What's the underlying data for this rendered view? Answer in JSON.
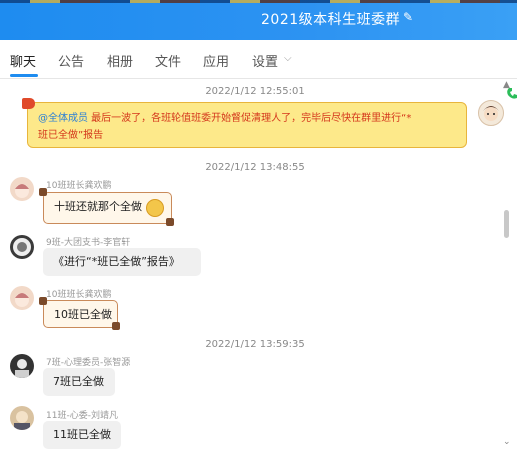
{
  "header": {
    "title": "2021级本科生班委群"
  },
  "tabs": [
    {
      "label": "聊天"
    },
    {
      "label": "公告"
    },
    {
      "label": "相册"
    },
    {
      "label": "文件"
    },
    {
      "label": "应用"
    },
    {
      "label": "设置"
    }
  ],
  "messages": {
    "t1": "2022/1/12 12:55:01",
    "announce": {
      "at": "@全体成员",
      "line1": " 最后一波了，各班轮值班委开始督促清理人了，完毕后尽快在群里进行“*",
      "line2": "班已全做”报告"
    },
    "t2": "2022/1/12 13:48:55",
    "m1": {
      "sender": "10班班长龚欢鹏",
      "text": "十班还就那个全做"
    },
    "m2": {
      "sender": "9班-大团支书-李官轩",
      "text": "《进行“*班已全做”报告》"
    },
    "m3": {
      "sender": "10班班长龚欢鹏",
      "text": "10班已全做"
    },
    "t3": "2022/1/12 13:59:35",
    "m4": {
      "sender": "7班-心理委员-张智源",
      "text": "7班已全做"
    },
    "m5": {
      "sender": "11班-心委-刘靖凡",
      "text": "11班已全做"
    }
  },
  "colors": {
    "accent": "#1e8cf0",
    "announce_bg": "#fde98a",
    "announce_text": "#d4371c",
    "at_text": "#2b7fd6"
  }
}
